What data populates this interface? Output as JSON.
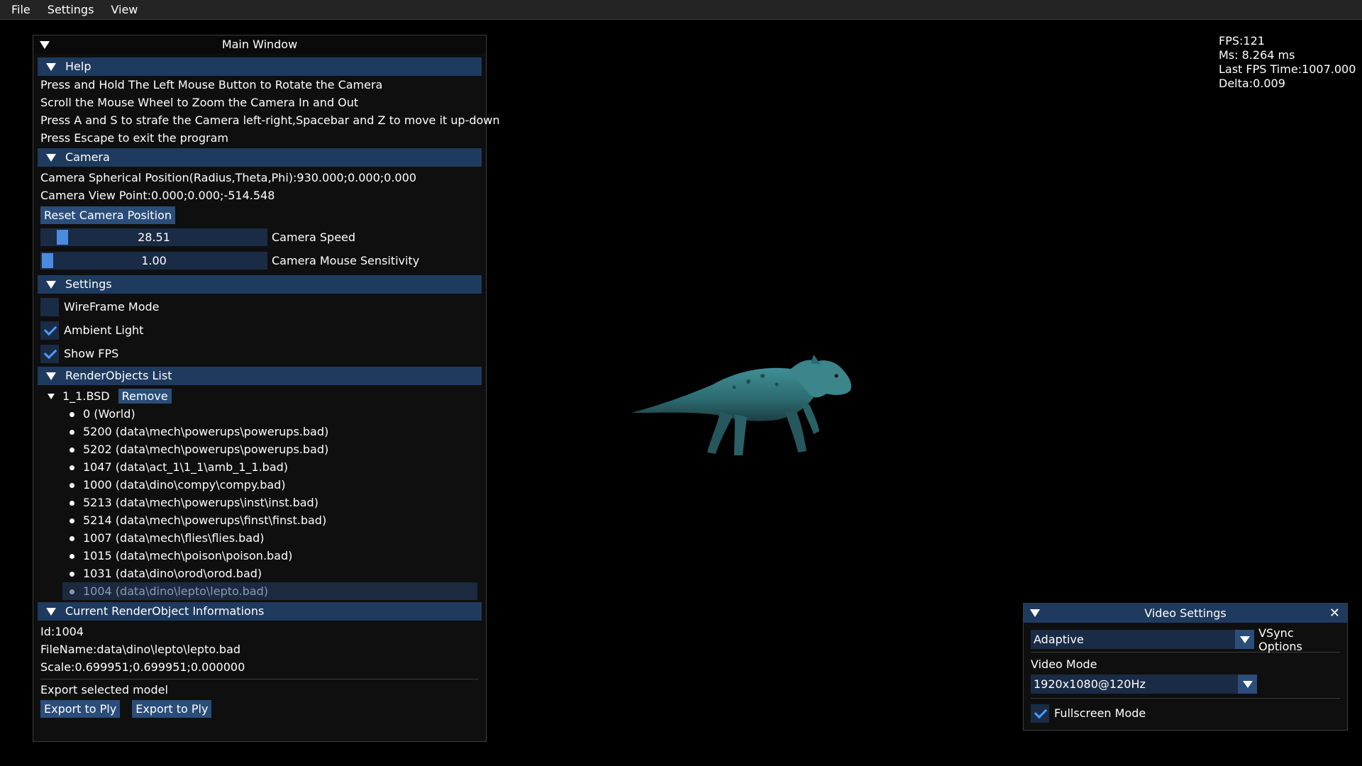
{
  "menu": [
    "File",
    "Settings",
    "View"
  ],
  "main_window": {
    "title": "Main Window",
    "help": {
      "header": "Help",
      "lines": [
        "Press and Hold The Left Mouse Button to Rotate the Camera",
        "Scroll the Mouse Wheel to Zoom the Camera In and Out",
        "Press A and S to strafe the Camera left-right,Spacebar and Z to move it up-down",
        "Press Escape to exit the program"
      ]
    },
    "camera": {
      "header": "Camera",
      "spherical": "Camera Spherical Position(Radius,Theta,Phi):930.000;0.000;0.000",
      "view_point": "Camera View Point:0.000;0.000;-514.548",
      "reset_button": "Reset Camera Position",
      "speed": {
        "value": "28.51",
        "label": "Camera Speed",
        "fraction": 0.07
      },
      "sensitivity": {
        "value": "1.00",
        "label": "Camera Mouse Sensitivity",
        "fraction": 0.0
      }
    },
    "settings": {
      "header": "Settings",
      "wireframe": {
        "label": "WireFrame Mode",
        "checked": false
      },
      "ambient": {
        "label": "Ambient Light",
        "checked": true
      },
      "show_fps": {
        "label": "Show FPS",
        "checked": true
      }
    },
    "render_objects": {
      "header": "RenderObjects List",
      "node": "1_1.BSD",
      "remove_button": "Remove",
      "items": [
        "0 (World)",
        "5200 (data\\mech\\powerups\\powerups.bad)",
        "5202 (data\\mech\\powerups\\powerups.bad)",
        "1047 (data\\act_1\\1_1\\amb_1_1.bad)",
        "1000 (data\\dino\\compy\\compy.bad)",
        "5213 (data\\mech\\powerups\\inst\\inst.bad)",
        "5214 (data\\mech\\powerups\\finst\\finst.bad)",
        "1007 (data\\mech\\flies\\flies.bad)",
        "1015 (data\\mech\\poison\\poison.bad)",
        "1031 (data\\dino\\orod\\orod.bad)",
        "1004 (data\\dino\\lepto\\lepto.bad)"
      ],
      "selected_index": 10
    },
    "current_info": {
      "header": "Current RenderObject Informations",
      "id": "Id:1004",
      "filename": "FileName:data\\dino\\lepto\\lepto.bad",
      "scale": "Scale:0.699951;0.699951;0.000000",
      "export_label": "Export selected model",
      "export_btn_1": "Export to Ply",
      "export_btn_2": "Export to Ply"
    }
  },
  "fps_overlay": {
    "fps": "FPS:121",
    "ms": "Ms: 8.264 ms",
    "last": "Last FPS Time:1007.000",
    "delta": "Delta:0.009"
  },
  "video_settings": {
    "title": "Video Settings",
    "close_icon": "✕",
    "vsync_value": "Adaptive",
    "vsync_label": "VSync Options",
    "video_mode_label": "Video Mode",
    "video_mode_value": "1920x1080@120Hz",
    "fullscreen": {
      "label": "Fullscreen Mode",
      "checked": true
    }
  },
  "colors": {
    "header_bg": "#1e3a5f",
    "button_bg": "#2a4d7a",
    "frame_bg": "#1a2b45",
    "check": "#4a9bff"
  }
}
